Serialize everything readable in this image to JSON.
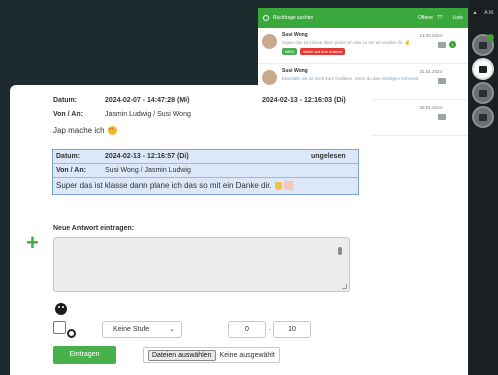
{
  "rail": {
    "top_left": "▲",
    "top_right": "A.M."
  },
  "back_panel": {
    "search_placeholder": "Rückfrage suchen",
    "filter_open": "Offene",
    "filter_open_count": "??",
    "filter_list": "Liste",
    "items": [
      {
        "name": "Susi Wong",
        "text": "Super das ist klasse dann plane ich das so mit ein Danke dir. ✌",
        "date": "13.02.2024",
        "tags": [
          "offen",
          "Warte auf Ihre Antwort"
        ],
        "tag_colors": [
          "#4caf50",
          "#e53935"
        ],
        "unread": "1"
      },
      {
        "name": "Susi Wong",
        "text": "Ebenfalls sie ist noch kurz Grafiken, wenn du das erledigen könntest",
        "date": "31.01.2024",
        "tags": [],
        "tag_colors": [],
        "unread": ""
      },
      {
        "name": "",
        "text": "",
        "date": "30.01.2024",
        "tags": [],
        "tag_colors": [],
        "unread": ""
      }
    ]
  },
  "message1": {
    "datum_label": "Datum:",
    "datum_value": "2024-02-07 - 14:47:28 (Mi)",
    "datum_right": "2024-02-13 - 12:16:03 (Di)",
    "von_label": "Von / An:",
    "von_value": "Jasmin Ludwig / Susi Wong",
    "text": "Jap mache ich"
  },
  "message2": {
    "datum_label": "Datum:",
    "datum_value": "2024-02-13 - 12:16:57 (Di)",
    "status": "ungelesen",
    "von_label": "Von / An:",
    "von_value": "Susi Wong / Jasmin Ludwig",
    "text": "Super das ist klasse dann plane ich das so mit ein Danke dir."
  },
  "reply": {
    "label": "Neue Antwort eintragen:",
    "level_select": "Keine Stufe",
    "hours": "0",
    "minutes": "10",
    "separator": ".",
    "submit": "Eintragen",
    "file_button": "Dateien auswählen",
    "file_status": "Keine ausgewählt"
  }
}
